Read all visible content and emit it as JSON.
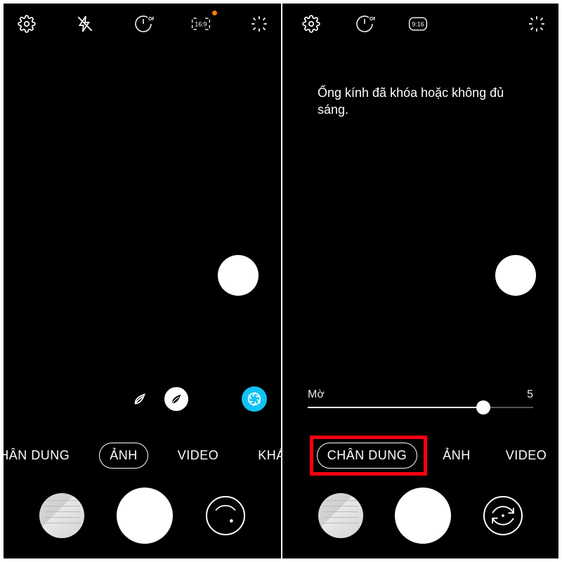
{
  "left": {
    "topbar": {
      "settings_icon": "settings",
      "flash_icon": "flash-off",
      "timer_icon": "timer-off",
      "timer_text": "OFF",
      "ratio_text": "16:9",
      "filters_icon": "sparkle"
    },
    "beauty": {
      "outline_icon": "leaf-outline",
      "filled_icon": "leaf",
      "magic_icon": "aperture"
    },
    "modes": [
      "CHÂN DUNG",
      "ẢNH",
      "VIDEO",
      "KHÁC"
    ],
    "active_mode_index": 1
  },
  "right": {
    "topbar": {
      "settings_icon": "settings",
      "timer_icon": "timer-off",
      "timer_text": "OFF",
      "ratio_text": "9:16",
      "filters_icon": "sparkle"
    },
    "warning": "Ống kính đã khóa hoặc không đủ sáng.",
    "slider": {
      "label_left": "Mờ",
      "label_right": "5",
      "value_pct": 78
    },
    "modes": [
      "CHÂN DUNG",
      "ẢNH",
      "VIDEO"
    ],
    "active_mode_index": 0,
    "highlight_mode_index": 0
  },
  "bottom": {
    "gallery": "gallery-thumb",
    "shutter": "shutter",
    "switch": "switch-camera"
  }
}
